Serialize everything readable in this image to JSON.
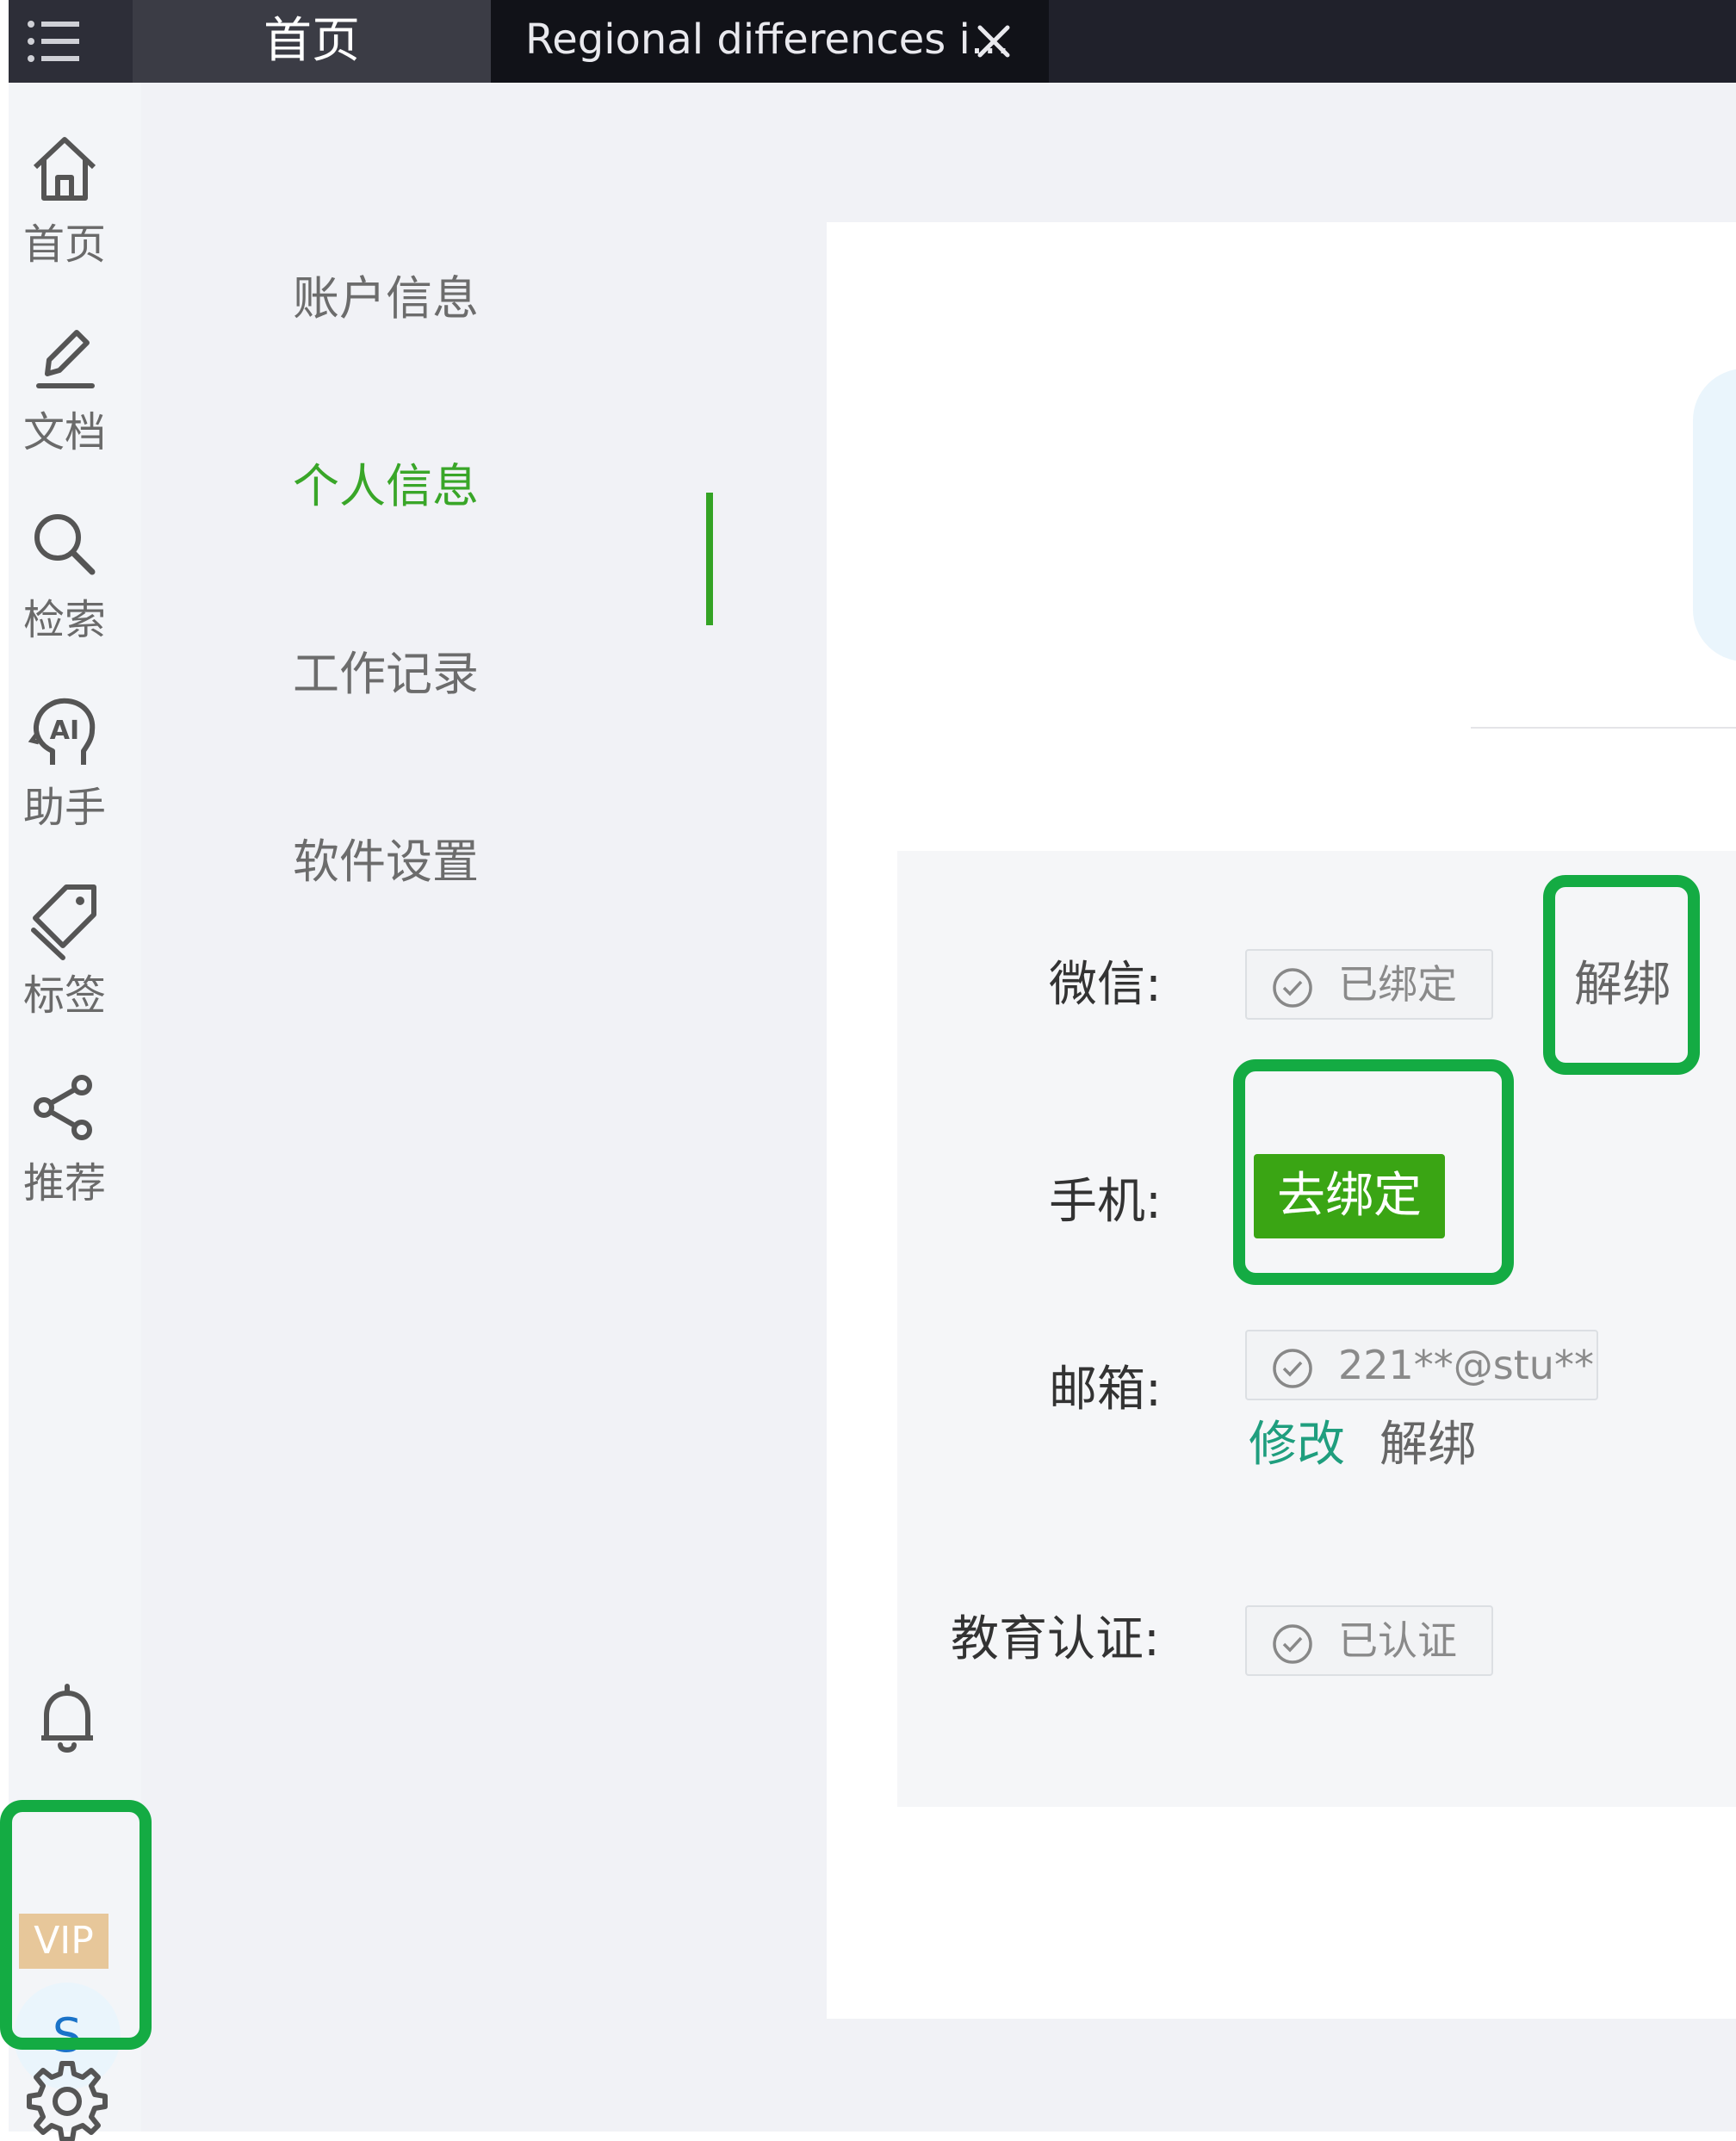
{
  "topbar": {
    "home_tab": "首页",
    "doc_tab": "Regional differences i..."
  },
  "rail": {
    "items": [
      {
        "label": "首页",
        "icon": "home-icon"
      },
      {
        "label": "文档",
        "icon": "pen-icon"
      },
      {
        "label": "检索",
        "icon": "search-icon"
      },
      {
        "label": "助手",
        "icon": "ai-head-icon"
      },
      {
        "label": "标签",
        "icon": "tag-icon"
      },
      {
        "label": "推荐",
        "icon": "share-icon"
      }
    ],
    "vip": "VIP",
    "avatar": "S"
  },
  "subnav": {
    "items": [
      "账户信息",
      "个人信息",
      "工作记录",
      "软件设置"
    ],
    "active_index": 1
  },
  "bindings": {
    "wechat": {
      "label": "微信:",
      "status": "已绑定",
      "action": "解绑"
    },
    "phone": {
      "label": "手机:",
      "action": "去绑定"
    },
    "email": {
      "label": "邮箱:",
      "value": "221**@stu**",
      "modify": "修改",
      "unbind": "解绑"
    },
    "edu": {
      "label": "教育认证:",
      "status": "已认证"
    }
  },
  "colors": {
    "accent_green": "#39a628",
    "highlight_green": "#14ab43",
    "bind_button": "#3aa514",
    "vip_badge": "#e7c79a"
  }
}
